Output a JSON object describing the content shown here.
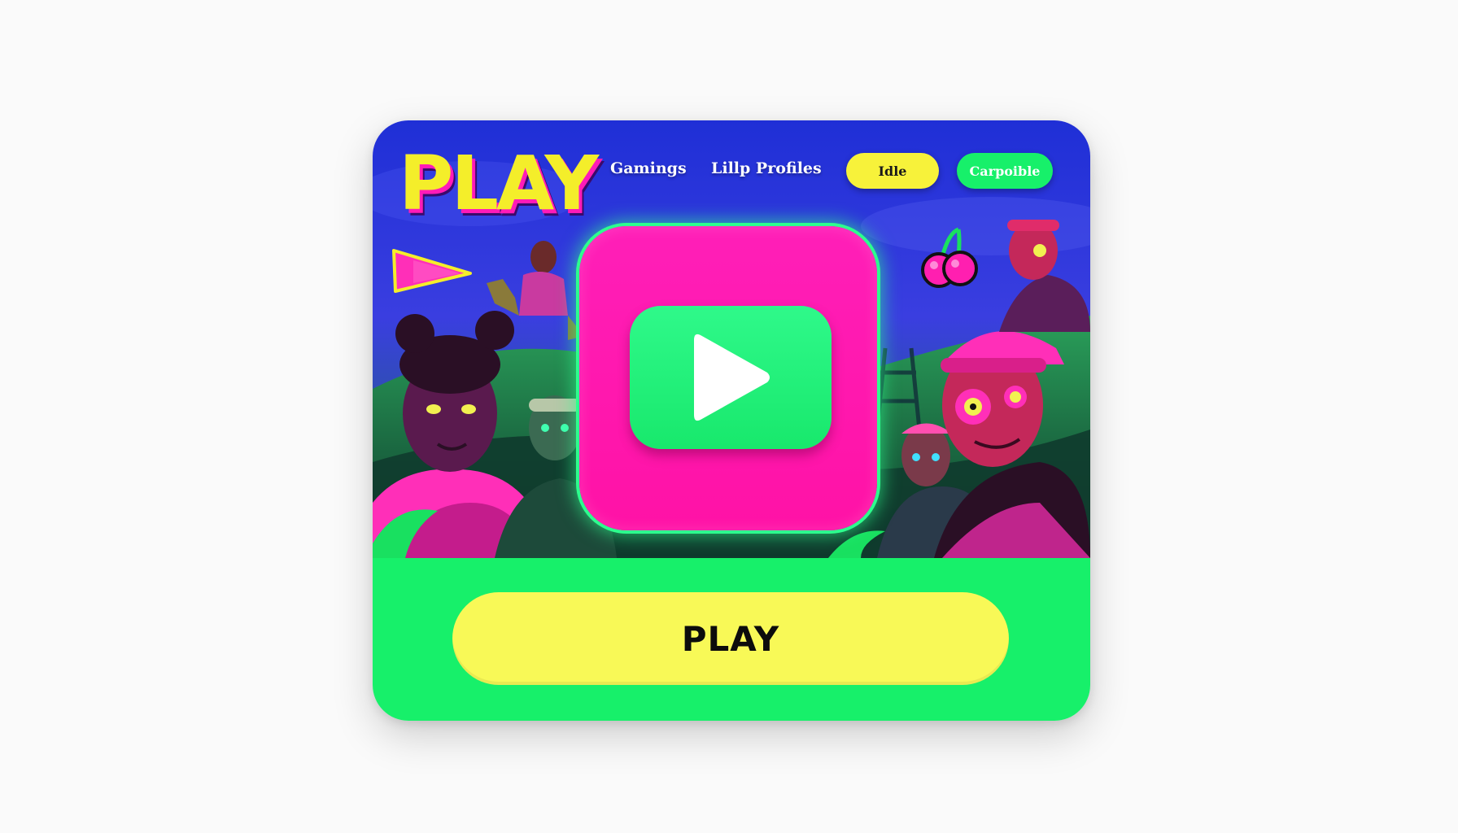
{
  "header": {
    "logo_text": "PLAY",
    "nav": [
      {
        "label": "Gamings"
      },
      {
        "label": "Lillp Profiles"
      }
    ],
    "pills": [
      {
        "label": "Idle",
        "color": "#f7f23a"
      },
      {
        "label": "Carpoible",
        "color": "#17f06a"
      }
    ]
  },
  "hero": {
    "play_tile_color": "#ff1fb8",
    "play_button_color": "#18e86c",
    "play_icon": "play-triangle-icon"
  },
  "footer": {
    "play_button_label": "PLAY",
    "background": "#17f06a",
    "button_color": "#f8f957"
  }
}
